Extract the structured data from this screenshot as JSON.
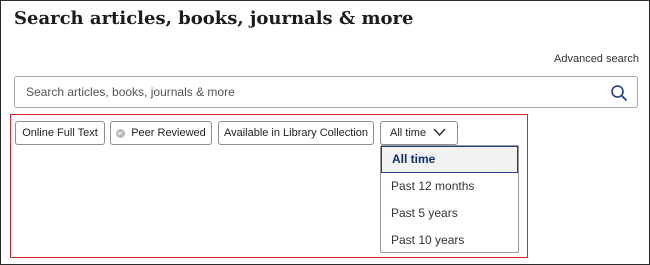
{
  "header": {
    "title": "Search articles, books, journals & more",
    "advanced_search": "Advanced search"
  },
  "search": {
    "placeholder": "Search articles, books, journals & more",
    "value": "",
    "icon": "search-icon"
  },
  "filters": {
    "online_full_text": "Online Full Text",
    "peer_reviewed": "Peer Reviewed",
    "library_collection": "Available in Library Collection",
    "time": {
      "selected": "All time",
      "options": [
        "All time",
        "Past 12 months",
        "Past 5 years",
        "Past 10 years"
      ]
    }
  },
  "colors": {
    "highlight_border": "#e0262a",
    "selected_text": "#0d2d6b",
    "search_icon": "#1d3f8a"
  }
}
